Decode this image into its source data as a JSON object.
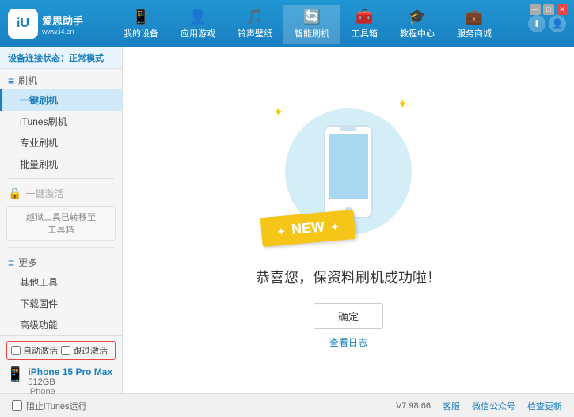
{
  "app": {
    "title": "爱思助手",
    "logo_icon": "iU",
    "logo_url": "www.i4.cn"
  },
  "nav": {
    "tabs": [
      {
        "id": "my-device",
        "icon": "📱",
        "label": "我的设备"
      },
      {
        "id": "apps-games",
        "icon": "👤",
        "label": "应用游戏"
      },
      {
        "id": "ringtones",
        "icon": "🎵",
        "label": "铃声壁纸"
      },
      {
        "id": "smart-flash",
        "icon": "🔄",
        "label": "智能刷机",
        "active": true
      },
      {
        "id": "tools",
        "icon": "🧰",
        "label": "工具箱"
      },
      {
        "id": "tutorial",
        "icon": "🎓",
        "label": "教程中心"
      },
      {
        "id": "service",
        "icon": "💼",
        "label": "服务商城"
      }
    ]
  },
  "sidebar": {
    "status_label": "设备连接状态：",
    "status_value": "正常模式",
    "flash_section": "刷机",
    "items": [
      {
        "id": "one-key-flash",
        "label": "一键刷机",
        "active": true
      },
      {
        "id": "itunes-flash",
        "label": "iTunes刷机"
      },
      {
        "id": "pro-flash",
        "label": "专业刷机"
      },
      {
        "id": "batch-flash",
        "label": "批量刷机"
      }
    ],
    "activation_section": "一键激活",
    "activation_disabled": true,
    "activation_notice": "越狱工具已转移至\n工具箱",
    "more_section": "更多",
    "more_items": [
      {
        "id": "other-tools",
        "label": "其他工具"
      },
      {
        "id": "download-firmware",
        "label": "下载固件"
      },
      {
        "id": "advanced",
        "label": "高级功能"
      }
    ],
    "auto_activate_label": "自动激活",
    "guided_activation_label": "跟过激活",
    "device_name": "iPhone 15 Pro Max",
    "device_storage": "512GB",
    "device_type": "iPhone",
    "stop_itunes_label": "阻止iTunes运行"
  },
  "content": {
    "success_message": "恭喜您，保资料刷机成功啦！",
    "confirm_button": "确定",
    "view_log_link": "查看日志",
    "new_label": "NEW"
  },
  "footer": {
    "version": "V7.98.66",
    "links": [
      "客服",
      "微信公众号",
      "检查更新"
    ]
  },
  "window_controls": {
    "minimize": "—",
    "maximize": "□",
    "close": "✕"
  }
}
